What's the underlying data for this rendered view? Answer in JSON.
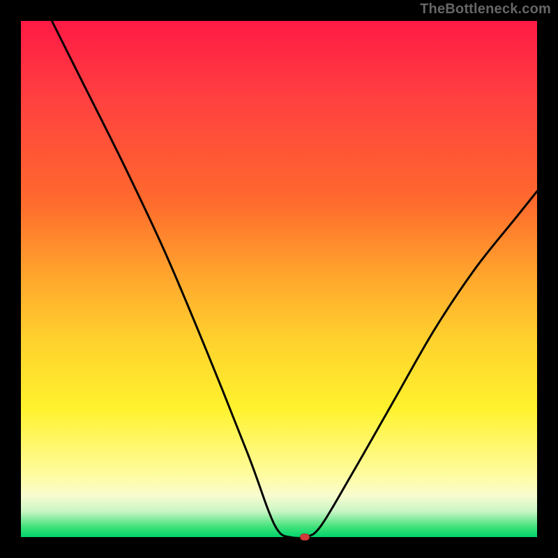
{
  "watermark": "TheBottleneck.com",
  "chart_data": {
    "type": "line",
    "title": "",
    "xlabel": "",
    "ylabel": "",
    "xlim": [
      0,
      100
    ],
    "ylim": [
      0,
      100
    ],
    "grid": false,
    "legend": false,
    "background_gradient": {
      "direction": "top-to-bottom",
      "stops": [
        {
          "pos": 0,
          "color": "#ff1a45"
        },
        {
          "pos": 15,
          "color": "#ff4040"
        },
        {
          "pos": 35,
          "color": "#ff6a2d"
        },
        {
          "pos": 50,
          "color": "#ffa82d"
        },
        {
          "pos": 62,
          "color": "#ffd22d"
        },
        {
          "pos": 75,
          "color": "#fff22d"
        },
        {
          "pos": 88,
          "color": "#fffca0"
        },
        {
          "pos": 92,
          "color": "#f8fccf"
        },
        {
          "pos": 95,
          "color": "#caf5c5"
        },
        {
          "pos": 98,
          "color": "#41e27b"
        },
        {
          "pos": 100,
          "color": "#00d46a"
        }
      ]
    },
    "series": [
      {
        "name": "bottleneck-curve",
        "color": "#000000",
        "points": [
          {
            "x": 6,
            "y": 100
          },
          {
            "x": 12,
            "y": 88
          },
          {
            "x": 20,
            "y": 72
          },
          {
            "x": 28,
            "y": 55
          },
          {
            "x": 36,
            "y": 36
          },
          {
            "x": 44,
            "y": 16
          },
          {
            "x": 48,
            "y": 5
          },
          {
            "x": 50,
            "y": 1
          },
          {
            "x": 52,
            "y": 0
          },
          {
            "x": 55,
            "y": 0
          },
          {
            "x": 58,
            "y": 2
          },
          {
            "x": 64,
            "y": 12
          },
          {
            "x": 72,
            "y": 26
          },
          {
            "x": 80,
            "y": 40
          },
          {
            "x": 88,
            "y": 52
          },
          {
            "x": 96,
            "y": 62
          },
          {
            "x": 100,
            "y": 67
          }
        ]
      }
    ],
    "marker": {
      "x": 55,
      "y": 0,
      "color": "#d33a3a"
    }
  }
}
